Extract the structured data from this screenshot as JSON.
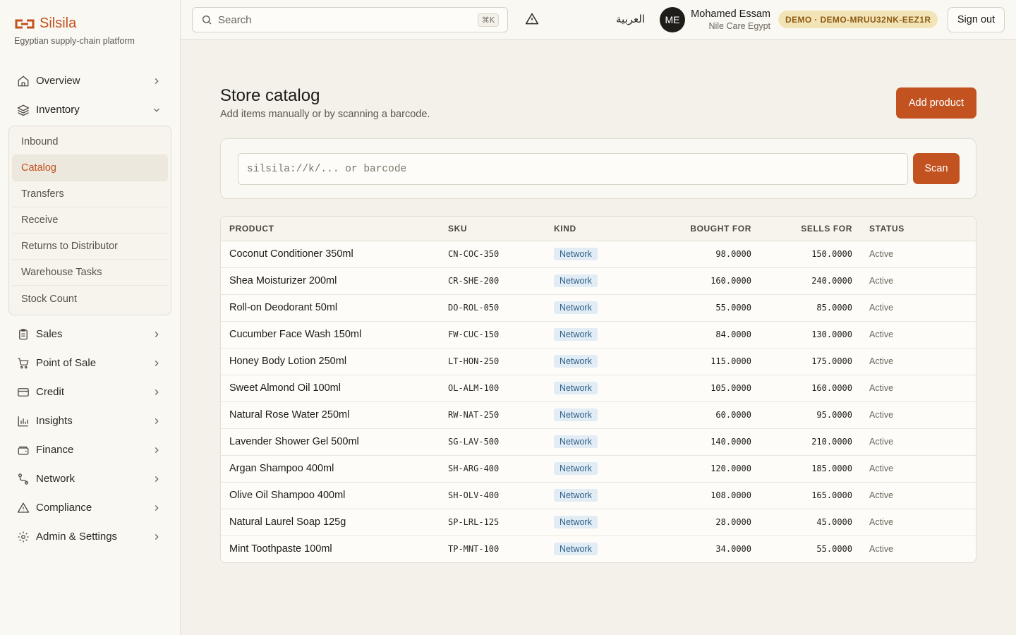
{
  "brand": {
    "name": "Silsila",
    "tagline": "Egyptian supply-chain platform"
  },
  "sidebar": {
    "items": [
      {
        "label": "Overview",
        "icon": "home-icon"
      },
      {
        "label": "Inventory",
        "icon": "layers-icon",
        "expanded": true,
        "children": [
          "Inbound",
          "Catalog",
          "Transfers",
          "Receive",
          "Returns to Distributor",
          "Warehouse Tasks",
          "Stock Count"
        ],
        "active_child": "Catalog"
      },
      {
        "label": "Sales",
        "icon": "clipboard-icon"
      },
      {
        "label": "Point of Sale",
        "icon": "cart-icon"
      },
      {
        "label": "Credit",
        "icon": "credit-card-icon"
      },
      {
        "label": "Insights",
        "icon": "bar-chart-icon"
      },
      {
        "label": "Finance",
        "icon": "wallet-icon"
      },
      {
        "label": "Network",
        "icon": "route-icon"
      },
      {
        "label": "Compliance",
        "icon": "warning-icon"
      },
      {
        "label": "Admin & Settings",
        "icon": "gear-icon"
      }
    ]
  },
  "topbar": {
    "search_placeholder": "Search",
    "search_shortcut": "⌘K",
    "language_toggle": "العربية",
    "user_initials": "ME",
    "user_name": "Mohamed Essam",
    "user_org": "Nile Care Egypt",
    "demo_badge": "DEMO · DEMO-MRUU32NK-EEZ1R",
    "signout_label": "Sign out"
  },
  "main": {
    "title": "Store catalog",
    "subtitle": "Add items manually or by scanning a barcode.",
    "add_button": "Add product",
    "scan_placeholder": "silsila://k/... or barcode",
    "scan_button": "Scan",
    "columns": [
      "PRODUCT",
      "SKU",
      "KIND",
      "BOUGHT FOR",
      "SELLS FOR",
      "STATUS"
    ],
    "rows": [
      {
        "product": "Coconut Conditioner 350ml",
        "sku": "CN-COC-350",
        "kind": "Network",
        "bought": "98.0000",
        "sells": "150.0000",
        "status": "Active"
      },
      {
        "product": "Shea Moisturizer 200ml",
        "sku": "CR-SHE-200",
        "kind": "Network",
        "bought": "160.0000",
        "sells": "240.0000",
        "status": "Active"
      },
      {
        "product": "Roll-on Deodorant 50ml",
        "sku": "DO-ROL-050",
        "kind": "Network",
        "bought": "55.0000",
        "sells": "85.0000",
        "status": "Active"
      },
      {
        "product": "Cucumber Face Wash 150ml",
        "sku": "FW-CUC-150",
        "kind": "Network",
        "bought": "84.0000",
        "sells": "130.0000",
        "status": "Active"
      },
      {
        "product": "Honey Body Lotion 250ml",
        "sku": "LT-HON-250",
        "kind": "Network",
        "bought": "115.0000",
        "sells": "175.0000",
        "status": "Active"
      },
      {
        "product": "Sweet Almond Oil 100ml",
        "sku": "OL-ALM-100",
        "kind": "Network",
        "bought": "105.0000",
        "sells": "160.0000",
        "status": "Active"
      },
      {
        "product": "Natural Rose Water 250ml",
        "sku": "RW-NAT-250",
        "kind": "Network",
        "bought": "60.0000",
        "sells": "95.0000",
        "status": "Active"
      },
      {
        "product": "Lavender Shower Gel 500ml",
        "sku": "SG-LAV-500",
        "kind": "Network",
        "bought": "140.0000",
        "sells": "210.0000",
        "status": "Active"
      },
      {
        "product": "Argan Shampoo 400ml",
        "sku": "SH-ARG-400",
        "kind": "Network",
        "bought": "120.0000",
        "sells": "185.0000",
        "status": "Active"
      },
      {
        "product": "Olive Oil Shampoo 400ml",
        "sku": "SH-OLV-400",
        "kind": "Network",
        "bought": "108.0000",
        "sells": "165.0000",
        "status": "Active"
      },
      {
        "product": "Natural Laurel Soap 125g",
        "sku": "SP-LRL-125",
        "kind": "Network",
        "bought": "28.0000",
        "sells": "45.0000",
        "status": "Active"
      },
      {
        "product": "Mint Toothpaste 100ml",
        "sku": "TP-MNT-100",
        "kind": "Network",
        "bought": "34.0000",
        "sells": "55.0000",
        "status": "Active"
      }
    ]
  },
  "colors": {
    "accent": "#c2521f",
    "background": "#f4f1ea",
    "kind_chip_bg": "#e1ecf5",
    "kind_chip_text": "#2f5f86",
    "demo_badge_bg": "#f3e4b8"
  }
}
